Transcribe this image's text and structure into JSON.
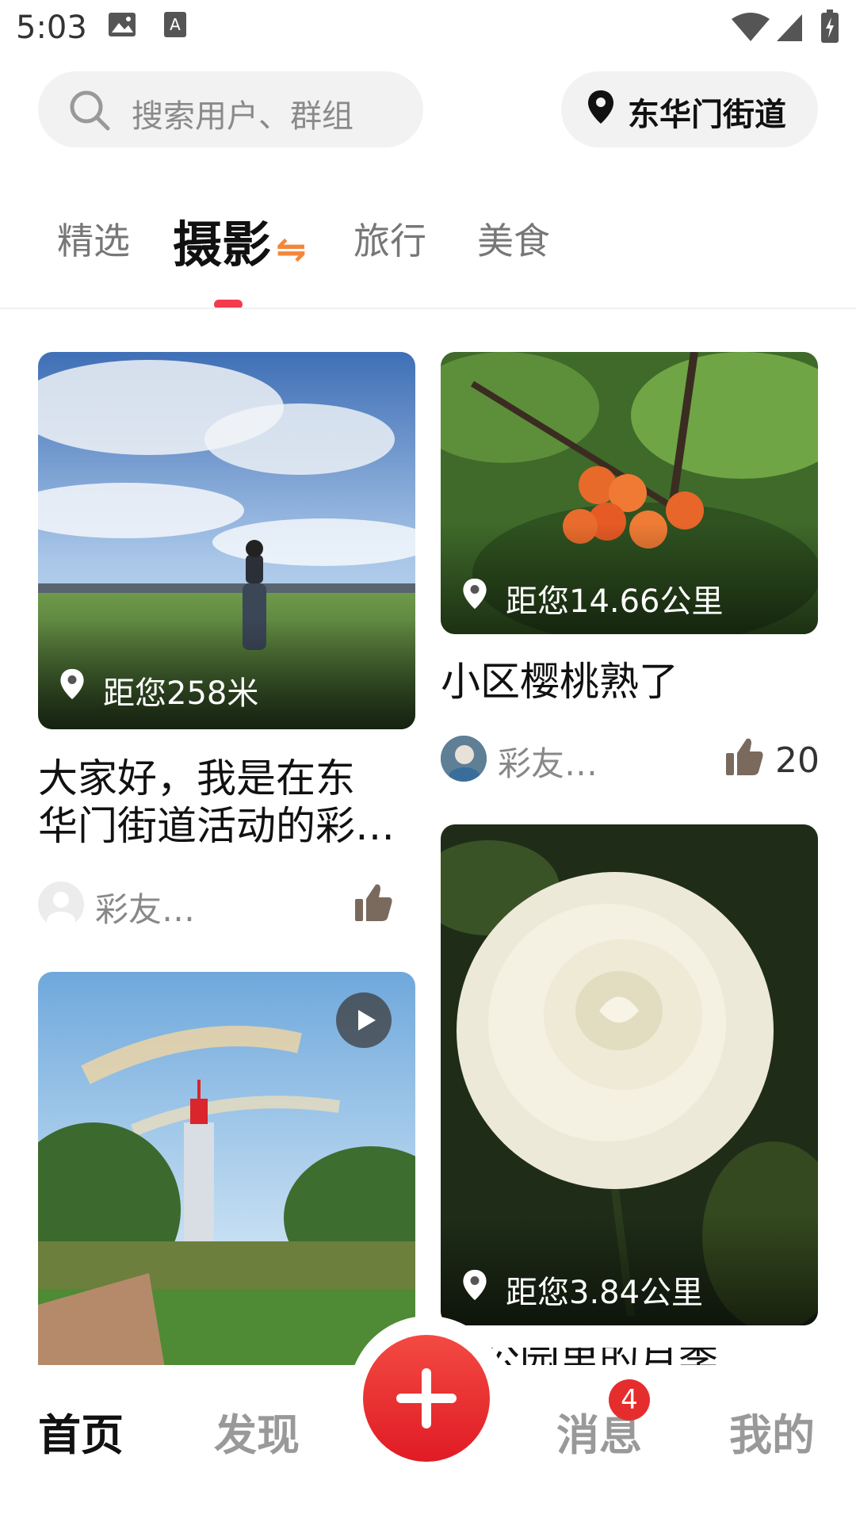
{
  "status_bar": {
    "time": "5:03"
  },
  "search": {
    "placeholder": "搜索用户、群组"
  },
  "location": {
    "label": "东华门街道"
  },
  "tabs": [
    {
      "label": "精选"
    },
    {
      "label": "摄影",
      "suffix": "⇋"
    },
    {
      "label": "旅行"
    },
    {
      "label": "美食"
    }
  ],
  "cards": [
    {
      "distance": "距您258米",
      "caption_line1": "大家好，我是在东",
      "caption_line2": "华门街道活动的彩…",
      "author": "彩友…",
      "likes": ""
    },
    {
      "distance": "距您14.66公里",
      "caption": "小区樱桃熟了",
      "author": "彩友…",
      "likes": "20"
    },
    {
      "distance": "距您3.84公里",
      "caption_partial": "…公园里的月季"
    },
    {
      "type": "video"
    }
  ],
  "bottom_nav": {
    "home": "首页",
    "discover": "发现",
    "messages": "消息",
    "messages_badge": "4",
    "mine": "我的"
  },
  "colors": {
    "accent": "#f43b4f",
    "fab": "#e8242c"
  }
}
